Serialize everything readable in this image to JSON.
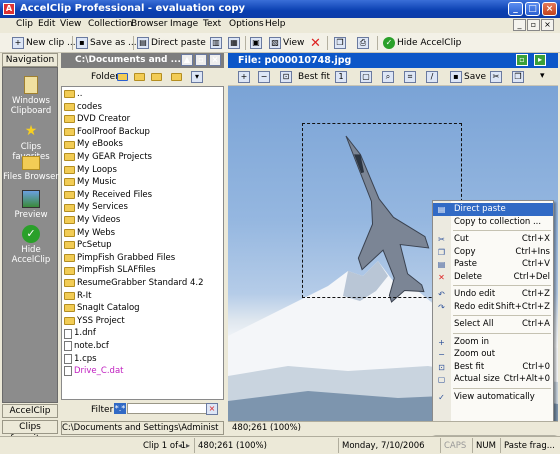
{
  "window": {
    "title": "AccelClip Professional - evaluation copy"
  },
  "menu": [
    "Clip",
    "Edit",
    "View",
    "Collection",
    "Browser",
    "Image",
    "Text",
    "Options",
    "Help"
  ],
  "toolbar": {
    "new_clip": "New clip ...",
    "save_as": "Save as ...",
    "direct_paste": "Direct paste",
    "view": "View",
    "hide": "Hide AccelClip"
  },
  "nav": {
    "header": "Navigation",
    "items": [
      {
        "label": "Windows Clipboard",
        "icon": "clipboard-icon"
      },
      {
        "label": "Clips favorites",
        "icon": "star-icon"
      },
      {
        "label": "Files Browser",
        "icon": "folders-icon"
      },
      {
        "label": "Preview",
        "icon": "preview-icon"
      },
      {
        "label": "Hide AccelClip",
        "icon": "hide-icon"
      }
    ],
    "footer1": "AccelClip",
    "footer2": "Clips favorites"
  },
  "browser": {
    "path_title": "C:\\Documents and ...",
    "folder_label": "Folder",
    "items": [
      {
        "name": "..",
        "type": "folder"
      },
      {
        "name": "codes",
        "type": "folder"
      },
      {
        "name": "DVD Creator",
        "type": "folder"
      },
      {
        "name": "FoolProof Backup",
        "type": "folder"
      },
      {
        "name": "My eBooks",
        "type": "folder"
      },
      {
        "name": "My GEAR Projects",
        "type": "folder"
      },
      {
        "name": "My Loops",
        "type": "folder"
      },
      {
        "name": "My Music",
        "type": "folder"
      },
      {
        "name": "My Received Files",
        "type": "folder"
      },
      {
        "name": "My Services",
        "type": "folder"
      },
      {
        "name": "My Videos",
        "type": "folder"
      },
      {
        "name": "My Webs",
        "type": "folder"
      },
      {
        "name": "PcSetup",
        "type": "folder"
      },
      {
        "name": "PimpFish Grabbed Files",
        "type": "folder"
      },
      {
        "name": "PimpFish SLAFfiles",
        "type": "folder"
      },
      {
        "name": "ResumeGrabber Standard 4.2",
        "type": "folder"
      },
      {
        "name": "R-It",
        "type": "folder"
      },
      {
        "name": "SnagIt Catalog",
        "type": "folder"
      },
      {
        "name": "YSS Project",
        "type": "folder"
      },
      {
        "name": "1.dnf",
        "type": "file"
      },
      {
        "name": "note.bcf",
        "type": "file"
      },
      {
        "name": "1.cps",
        "type": "file"
      },
      {
        "name": "Drive_C.dat",
        "type": "file",
        "color": "#c020c0"
      }
    ],
    "filter_label": "Filter",
    "filter_value": "*.*",
    "status_path": "C:\\Documents and Settings\\Administ"
  },
  "image_panel": {
    "title": "File: p000010748.jpg",
    "best_fit": "Best fit",
    "save": "Save"
  },
  "context_menu": [
    {
      "label": "Direct paste",
      "shortcut": "",
      "icon": "paste-icon",
      "highlight": true
    },
    {
      "label": "Copy to collection ...",
      "shortcut": "",
      "icon": ""
    },
    {
      "sep": true
    },
    {
      "label": "Cut",
      "shortcut": "Ctrl+X",
      "icon": "scissors-icon"
    },
    {
      "label": "Copy",
      "shortcut": "Ctrl+Ins",
      "icon": "copy-icon"
    },
    {
      "label": "Paste",
      "shortcut": "Ctrl+V",
      "icon": "paste-icon"
    },
    {
      "label": "Delete",
      "shortcut": "Ctrl+Del",
      "icon": "delete-icon"
    },
    {
      "sep": true
    },
    {
      "label": "Undo edit",
      "shortcut": "Ctrl+Z",
      "icon": "undo-icon"
    },
    {
      "label": "Redo edit",
      "shortcut": "Shift+Ctrl+Z",
      "icon": "redo-icon"
    },
    {
      "sep": true
    },
    {
      "label": "Select All",
      "shortcut": "Ctrl+A",
      "icon": ""
    },
    {
      "sep": true
    },
    {
      "label": "Zoom in",
      "shortcut": "",
      "icon": "zoom-in-icon"
    },
    {
      "label": "Zoom out",
      "shortcut": "",
      "icon": "zoom-out-icon"
    },
    {
      "label": "Best fit",
      "shortcut": "Ctrl+0",
      "icon": "best-fit-icon"
    },
    {
      "label": "Actual size",
      "shortcut": "Ctrl+Alt+0",
      "icon": "actual-size-icon"
    },
    {
      "sep": true
    },
    {
      "label": "View automatically",
      "shortcut": "",
      "icon": "check-icon"
    }
  ],
  "status": {
    "zoom_text": "480;261 (100%)",
    "clip_count": "Clip 1 of 1",
    "date": "Monday, 7/10/2006",
    "caps": "CAPS",
    "num": "NUM",
    "mode": "Paste frag..."
  }
}
